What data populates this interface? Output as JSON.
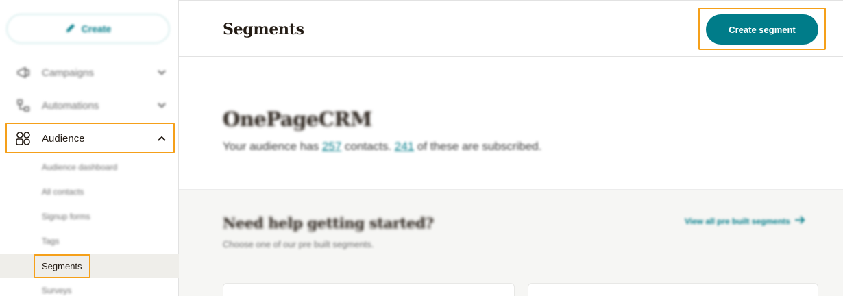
{
  "sidebar": {
    "create_label": "Create",
    "nav": [
      {
        "label": "Campaigns",
        "icon": "campaigns-icon"
      },
      {
        "label": "Automations",
        "icon": "automations-icon"
      },
      {
        "label": "Audience",
        "icon": "audience-icon"
      }
    ],
    "audience_sub": [
      {
        "label": "Audience dashboard"
      },
      {
        "label": "All contacts"
      },
      {
        "label": "Signup forms"
      },
      {
        "label": "Tags"
      },
      {
        "label": "Segments"
      },
      {
        "label": "Surveys"
      }
    ]
  },
  "header": {
    "title": "Segments",
    "create_segment_label": "Create segment"
  },
  "audience": {
    "name": "OnePageCRM",
    "summary_prefix": "Your audience has ",
    "contacts_count": "257",
    "summary_mid": " contacts. ",
    "subscribed_count": "241",
    "summary_suffix": " of these are subscribed."
  },
  "help": {
    "title": "Need help getting started?",
    "subtitle": "Choose one of our pre built segments.",
    "view_all_label": "View all pre built segments"
  },
  "colors": {
    "accent": "#007c89",
    "highlight": "#f5a01a",
    "active_bg": "#efeeea"
  }
}
